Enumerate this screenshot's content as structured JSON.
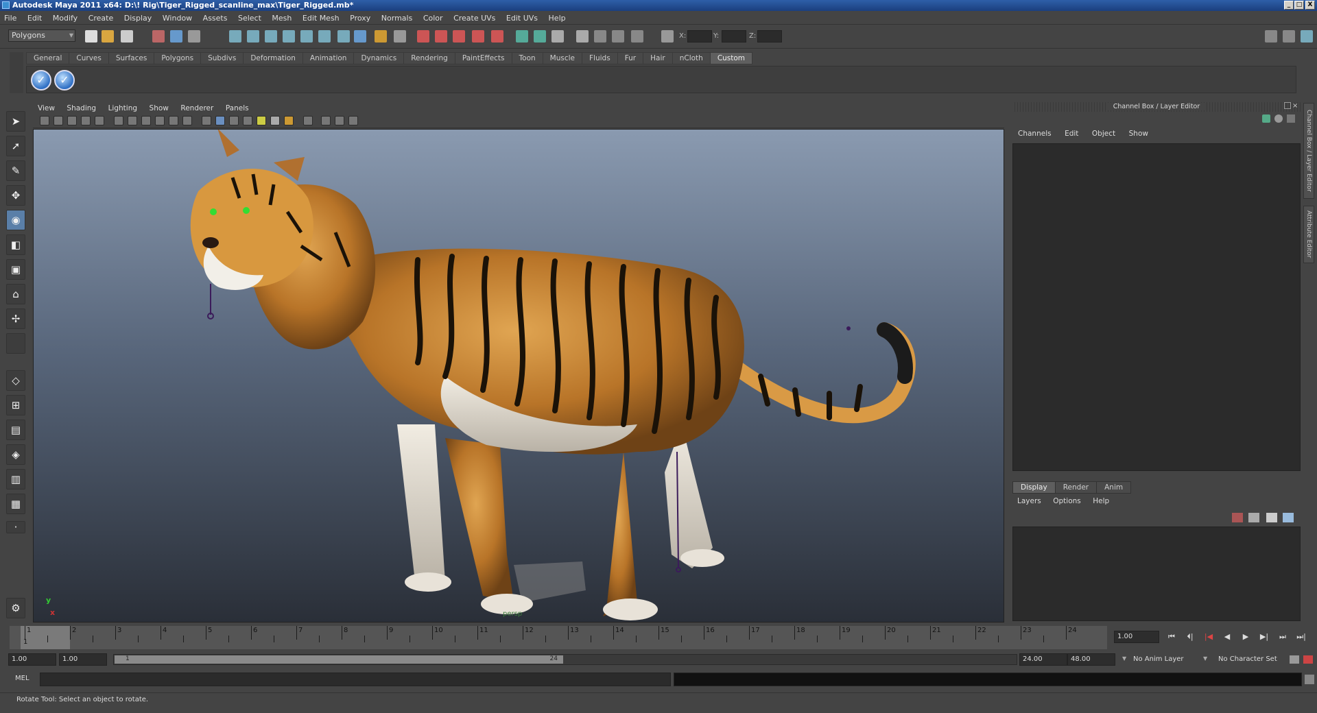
{
  "window": {
    "title": "Autodesk Maya 2011 x64: D:\\! Rig\\Tiger_Rigged_scanline_max\\Tiger_Rigged.mb*",
    "minimize": "_",
    "maximize": "□",
    "close": "X"
  },
  "menubar": [
    "File",
    "Edit",
    "Modify",
    "Create",
    "Display",
    "Window",
    "Assets",
    "Select",
    "Mesh",
    "Edit Mesh",
    "Proxy",
    "Normals",
    "Color",
    "Create UVs",
    "Edit UVs",
    "Help"
  ],
  "statusline": {
    "mode": "Polygons",
    "x_label": "X:",
    "y_label": "Y:",
    "z_label": "Z:"
  },
  "shelf": {
    "tabs": [
      "General",
      "Curves",
      "Surfaces",
      "Polygons",
      "Subdivs",
      "Deformation",
      "Animation",
      "Dynamics",
      "Rendering",
      "PaintEffects",
      "Toon",
      "Muscle",
      "Fluids",
      "Fur",
      "Hair",
      "nCloth",
      "Custom"
    ],
    "active": "Custom",
    "buttons": [
      "✓",
      "✓"
    ]
  },
  "viewport": {
    "menu": [
      "View",
      "Shading",
      "Lighting",
      "Show",
      "Renderer",
      "Panels"
    ],
    "camera_label": "persp",
    "axis_y": "y",
    "axis_x": "x"
  },
  "channel_box": {
    "title": "Channel Box / Layer Editor",
    "menu": [
      "Channels",
      "Edit",
      "Object",
      "Show"
    ]
  },
  "layer_editor": {
    "tabs": [
      "Display",
      "Render",
      "Anim"
    ],
    "active": "Display",
    "menu": [
      "Layers",
      "Options",
      "Help"
    ]
  },
  "side_tabs": [
    "Channel Box / Layer Editor",
    "Attribute Editor"
  ],
  "time_slider": {
    "ticks": [
      1,
      2,
      3,
      4,
      5,
      6,
      7,
      8,
      9,
      10,
      11,
      12,
      13,
      14,
      15,
      16,
      17,
      18,
      19,
      20,
      21,
      22,
      23,
      24
    ],
    "current_marker": "1",
    "current_frame": "1.00"
  },
  "playback": [
    "⏮",
    "⏴|",
    "|◀",
    "◀",
    "▶",
    "▶|",
    "⏭",
    "⏭|"
  ],
  "range": {
    "start": "1.00",
    "anim_start": "1.00",
    "slider_start_label": "1",
    "slider_end_label": "24",
    "anim_end": "24.00",
    "end": "48.00",
    "anim_layer": "No Anim Layer",
    "character_set": "No Character Set"
  },
  "command_line": {
    "label": "MEL"
  },
  "help_line": "Rotate Tool: Select an object to rotate.",
  "colors": {
    "ui_bg": "#444444",
    "title_bar": "#1b3f7e",
    "viewport_top": "#8a9ab0",
    "viewport_bottom": "#2a2f38"
  }
}
